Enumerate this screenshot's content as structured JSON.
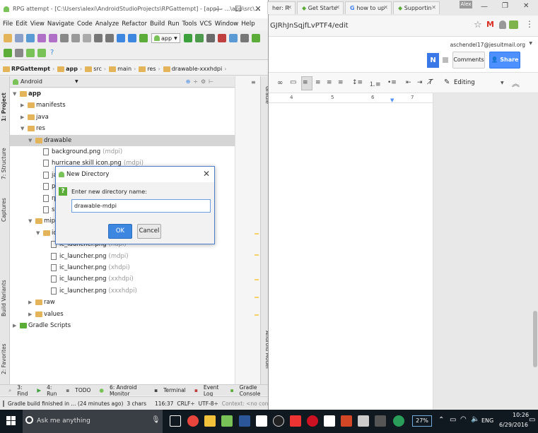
{
  "as": {
    "title": "RPG attempt - [C:\\Users\\alexi\\AndroidStudioProjects\\RPGattempt] - [app] - ...\\app\\src\\...",
    "menu": [
      "File",
      "Edit",
      "View",
      "Navigate",
      "Code",
      "Analyze",
      "Refactor",
      "Build",
      "Run",
      "Tools",
      "VCS",
      "Window",
      "Help"
    ],
    "run_config": "app",
    "breadcrumbs": [
      "RPGattempt",
      "app",
      "src",
      "main",
      "res",
      "drawable-xxxhdpi"
    ],
    "view_mode": "Android",
    "left_tabs": [
      "1: Project",
      "7: Structure",
      "Captures",
      "Build Variants",
      "2: Favorites"
    ],
    "right_tabs": [
      "Gradle",
      "Android Model"
    ],
    "tree": [
      {
        "label": "app",
        "hint": "",
        "depth": 0,
        "arrow": "▼",
        "icon": "folder"
      },
      {
        "label": "manifests",
        "hint": "",
        "depth": 1,
        "arrow": "▶",
        "icon": "folder"
      },
      {
        "label": "java",
        "hint": "",
        "depth": 1,
        "arrow": "▶",
        "icon": "folder"
      },
      {
        "label": "res",
        "hint": "",
        "depth": 1,
        "arrow": "▼",
        "icon": "folder"
      },
      {
        "label": "drawable",
        "hint": "",
        "depth": 2,
        "arrow": "▼",
        "icon": "folder"
      },
      {
        "label": "background.png",
        "hint": "(mdpi)",
        "depth": 3,
        "arrow": "",
        "icon": "file"
      },
      {
        "label": "hurricane skill icon.png",
        "hint": "(mdpi)",
        "depth": 3,
        "arrow": "",
        "icon": "file"
      },
      {
        "label": "ja",
        "hint": "",
        "depth": 3,
        "arrow": "",
        "icon": "file"
      },
      {
        "label": "p",
        "hint": "",
        "depth": 3,
        "arrow": "",
        "icon": "file"
      },
      {
        "label": "rp",
        "hint": "",
        "depth": 3,
        "arrow": "",
        "icon": "file"
      },
      {
        "label": "sv",
        "hint": "",
        "depth": 3,
        "arrow": "",
        "icon": "file"
      },
      {
        "label": "mipm",
        "hint": "",
        "depth": 2,
        "arrow": "▼",
        "icon": "folder"
      },
      {
        "label": "ic",
        "hint": "",
        "depth": 3,
        "arrow": "▼",
        "icon": "folder"
      },
      {
        "label": "ic_launcher.png",
        "hint": "(hdpi)",
        "depth": 4,
        "arrow": "",
        "icon": "file"
      },
      {
        "label": "ic_launcher.png",
        "hint": "(mdpi)",
        "depth": 4,
        "arrow": "",
        "icon": "file"
      },
      {
        "label": "ic_launcher.png",
        "hint": "(xhdpi)",
        "depth": 4,
        "arrow": "",
        "icon": "file"
      },
      {
        "label": "ic_launcher.png",
        "hint": "(xxhdpi)",
        "depth": 4,
        "arrow": "",
        "icon": "file"
      },
      {
        "label": "ic_launcher.png",
        "hint": "(xxxhdpi)",
        "depth": 4,
        "arrow": "",
        "icon": "file"
      },
      {
        "label": "raw",
        "hint": "",
        "depth": 2,
        "arrow": "▶",
        "icon": "folder"
      },
      {
        "label": "values",
        "hint": "",
        "depth": 2,
        "arrow": "▶",
        "icon": "folder"
      },
      {
        "label": "Gradle Scripts",
        "hint": "",
        "depth": 0,
        "arrow": "▶",
        "icon": "gradle"
      }
    ],
    "bottom_tabs": [
      "3: Find",
      "4: Run",
      "TODO",
      "6: Android Monitor",
      "Terminal",
      "Event Log",
      "Gradle Console"
    ],
    "status": {
      "message": "Gradle build finished in ... (24 minutes ago)",
      "chars": "3 chars",
      "position": "116:37",
      "line_sep": "CRLF÷",
      "encoding": "UTF-8÷",
      "context": "Context: <no context>"
    }
  },
  "dialog": {
    "title": "New Directory",
    "prompt": "Enter new directory name:",
    "input_value": "drawable-mdpi",
    "ok_label": "OK",
    "cancel_label": "Cancel"
  },
  "chrome": {
    "tabs": [
      "her: R",
      "Get Starte",
      "how to up",
      "Supportin"
    ],
    "profile": "Alex",
    "url_fragment": "GJRhJnSqjfLvPTF4/edit"
  },
  "docs": {
    "user_email": "aschendel17@jesuitmail.org",
    "logo_letter": "N",
    "comments_label": "Comments",
    "share_label": "Share",
    "editing_label": "Editing",
    "ruler_marks": [
      "4",
      "5",
      "6",
      "7"
    ]
  },
  "taskbar": {
    "search_placeholder": "Ask me anything",
    "battery": "27%",
    "lang": "ENG",
    "time": "10:26",
    "date": "6/29/2016"
  },
  "colors": {
    "android_green": "#78c257",
    "ok_blue": "#3d87e0",
    "share_blue": "#4d90fe",
    "taskbar_bg": "#101820"
  }
}
